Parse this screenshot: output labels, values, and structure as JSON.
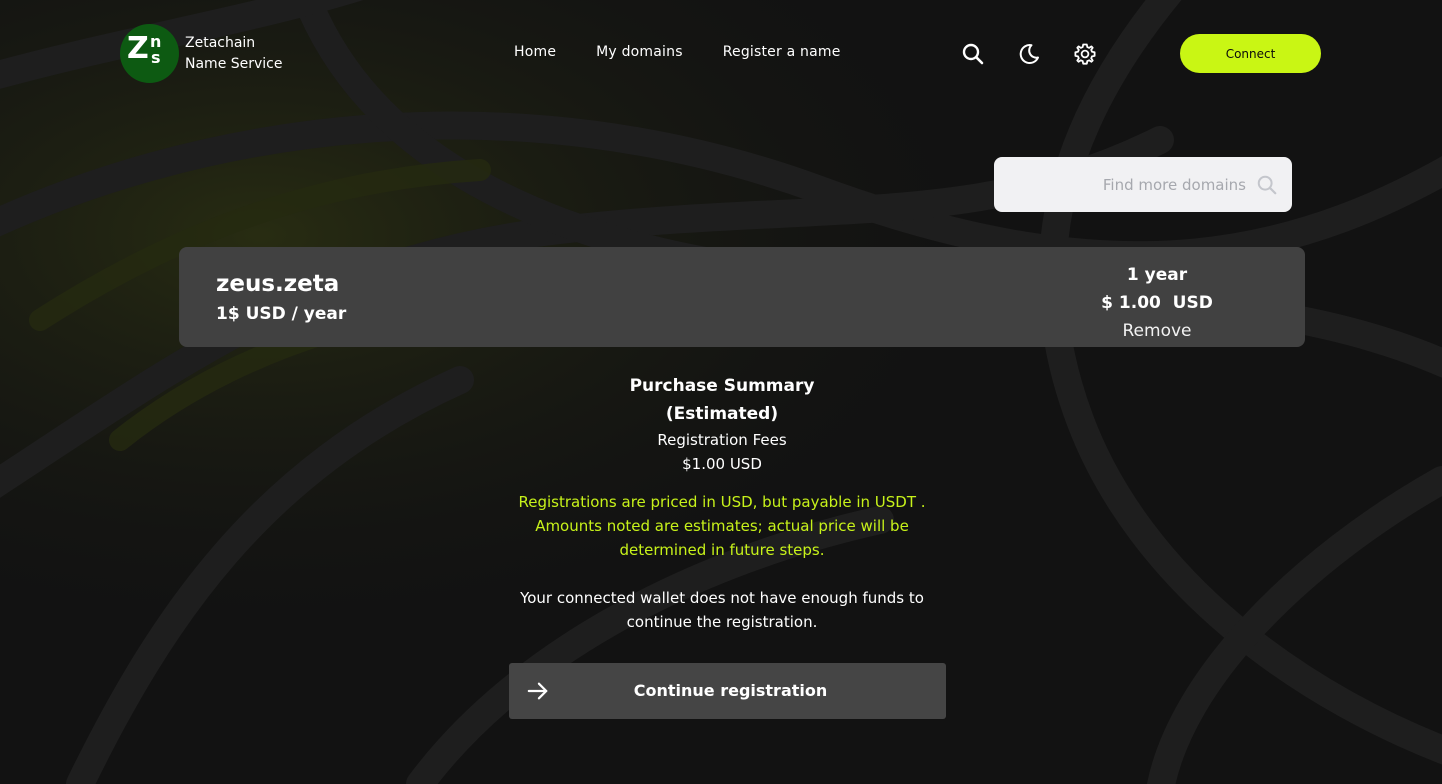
{
  "brand": {
    "line1": "Zetachain",
    "line2": "Name Service",
    "mark_z": "Z",
    "mark_n": "n",
    "mark_s": "s"
  },
  "nav": {
    "home": "Home",
    "my_domains": "My domains",
    "register": "Register a name"
  },
  "header_icons": [
    "search-icon",
    "moon-icon",
    "gear-icon"
  ],
  "connect_label": "Connect",
  "search": {
    "placeholder": "Find more domains"
  },
  "cart_item": {
    "domain": "zeus.zeta",
    "price_per_year": "1$ USD / year",
    "duration": "1 year",
    "total": "$ 1.00  USD",
    "remove_label": "Remove"
  },
  "summary": {
    "title_line1": "Purchase Summary",
    "title_line2": "(Estimated)",
    "fees_label": "Registration Fees",
    "fees_value": "$1.00 USD",
    "notice": "Registrations are priced in USD, but payable in USDT . Amounts noted are estimates; actual price will be determined in future steps.",
    "warning": "Your connected wallet does not have enough funds to continue the registration."
  },
  "continue_label": "Continue registration",
  "colors": {
    "accent": "#c9f614",
    "notice_text": "#c7f21a",
    "background": "#121212",
    "card": "#414141",
    "logo_bg": "#0d5a12"
  }
}
